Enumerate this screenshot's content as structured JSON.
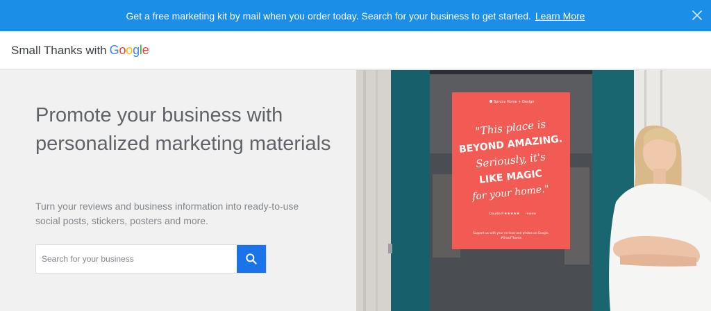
{
  "banner": {
    "message": "Get a free marketing kit by mail when you order today. Search for your business to get started.",
    "link_label": "Learn More",
    "close_icon": "close-icon",
    "background": "#1b8ee8"
  },
  "header": {
    "brand_text": "Small Thanks with",
    "brand_google": [
      "G",
      "o",
      "o",
      "g",
      "l",
      "e"
    ],
    "brand_google_colors": [
      "#4285F4",
      "#EA4335",
      "#FBBC05",
      "#4285F4",
      "#34A853",
      "#EA4335"
    ]
  },
  "main": {
    "headline": "Promote your business with personalized marketing materials",
    "subtext": "Turn your reviews and business information into ready-to-use social posts, stickers, posters and more.",
    "search": {
      "placeholder": "Search for your business",
      "value": "",
      "button_icon": "search-icon",
      "button_color": "#1a73e8"
    }
  },
  "hero": {
    "poster_business": "Spruce Home + Design",
    "poster_quote_lines": [
      "\"This place is",
      "BEYOND AMAZING.",
      "Seriously, it's",
      "LIKE MAGIC",
      "for your home.\""
    ],
    "poster_reviewer": "Claudia P.",
    "poster_reviewer_suffix": "review",
    "poster_footer": "Support us with your reviews and photos on Google.",
    "poster_hashtag": "#SmallThanks",
    "poster_color": "#f25a54"
  }
}
